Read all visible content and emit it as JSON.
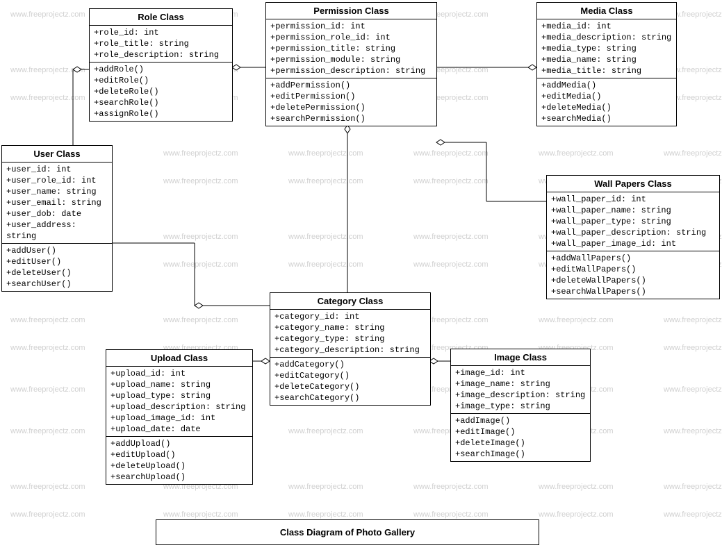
{
  "watermark_text": "www.freeprojectz.com",
  "diagram_title": "Class Diagram of Photo Gallery",
  "classes": {
    "role": {
      "title": "Role Class",
      "attrs": [
        "+role_id: int",
        "+role_title: string",
        "+role_description: string"
      ],
      "ops": [
        "+addRole()",
        "+editRole()",
        "+deleteRole()",
        "+searchRole()",
        "+assignRole()"
      ]
    },
    "permission": {
      "title": "Permission Class",
      "attrs": [
        "+permission_id: int",
        "+permission_role_id: int",
        "+permission_title: string",
        "+permission_module: string",
        "+permission_description: string"
      ],
      "ops": [
        "+addPermission()",
        "+editPermission()",
        "+deletePermission()",
        "+searchPermission()"
      ]
    },
    "media": {
      "title": "Media Class",
      "attrs": [
        "+media_id: int",
        "+media_description: string",
        "+media_type: string",
        "+media_name: string",
        "+media_title: string"
      ],
      "ops": [
        "+addMedia()",
        "+editMedia()",
        "+deleteMedia()",
        "+searchMedia()"
      ]
    },
    "user": {
      "title": "User Class",
      "attrs": [
        "+user_id: int",
        "+user_role_id: int",
        "+user_name: string",
        "+user_email: string",
        "+user_dob: date",
        "+user_address: string"
      ],
      "ops": [
        "+addUser()",
        "+editUser()",
        "+deleteUser()",
        "+searchUser()"
      ]
    },
    "wallpapers": {
      "title": "Wall Papers Class",
      "attrs": [
        "+wall_paper_id: int",
        "+wall_paper_name: string",
        "+wall_paper_type: string",
        "+wall_paper_description: string",
        "+wall_paper_image_id: int"
      ],
      "ops": [
        "+addWallPapers()",
        "+editWallPapers()",
        "+deleteWallPapers()",
        "+searchWallPapers()"
      ]
    },
    "category": {
      "title": "Category Class",
      "attrs": [
        "+category_id: int",
        "+category_name: string",
        "+category_type: string",
        "+category_description: string"
      ],
      "ops": [
        "+addCategory()",
        "+editCategory()",
        "+deleteCategory()",
        "+searchCategory()"
      ]
    },
    "upload": {
      "title": "Upload Class",
      "attrs": [
        "+upload_id: int",
        "+upload_name: string",
        "+upload_type: string",
        "+upload_description: string",
        "+upload_image_id: int",
        "+upload_date: date"
      ],
      "ops": [
        "+addUpload()",
        "+editUpload()",
        "+deleteUpload()",
        "+searchUpload()"
      ]
    },
    "image": {
      "title": "Image Class",
      "attrs": [
        "+image_id: int",
        "+image_name: string",
        "+image_description: string",
        "+image_type: string"
      ],
      "ops": [
        "+addImage()",
        "+editImage()",
        "+deleteImage()",
        "+searchImage()"
      ]
    }
  }
}
